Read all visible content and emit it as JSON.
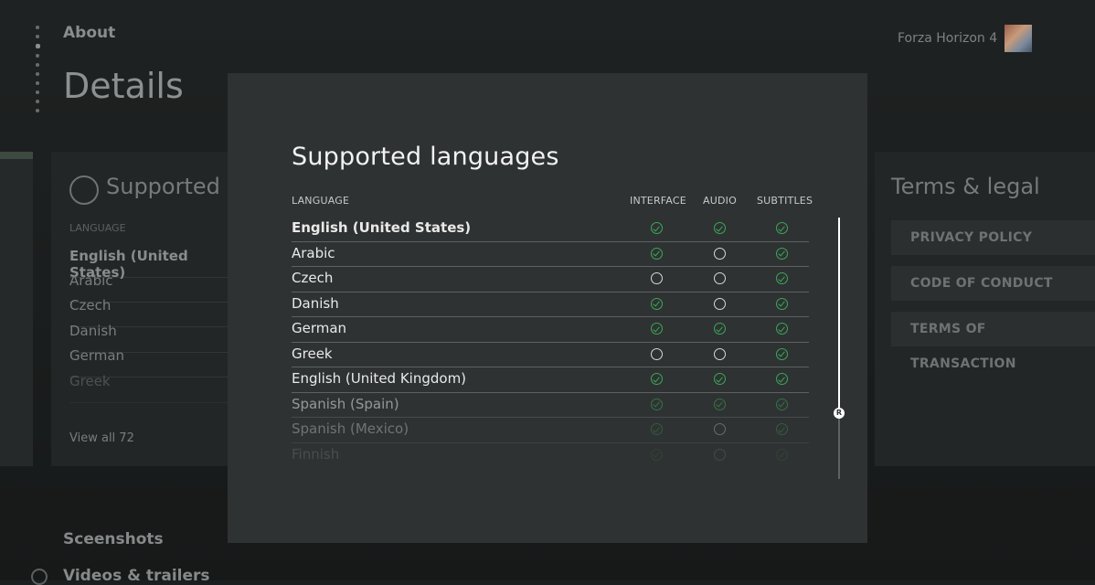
{
  "background": {
    "about_label": "About",
    "page_title": "Details",
    "game_title": "Forza Horizon 4",
    "languages_card": {
      "title": "Supported la",
      "header": "LANGUAGE",
      "rows": [
        "English (United States)",
        "Arabic",
        "Czech",
        "Danish",
        "German",
        "Greek"
      ],
      "view_all": "View all 72"
    },
    "terms_card": {
      "title": "Terms & legal",
      "buttons": [
        "PRIVACY POLICY",
        "CODE OF CONDUCT",
        "TERMS OF TRANSACTION"
      ]
    },
    "screenshots_label": "Sceenshots",
    "videos_label": "Videos & trailers"
  },
  "modal": {
    "title": "Supported languages",
    "columns": {
      "language": "LANGUAGE",
      "interface": "INTERFACE",
      "audio": "AUDIO",
      "subtitles": "SUBTITLES"
    },
    "rows": [
      {
        "name": "English (United States)",
        "interface": true,
        "audio": true,
        "subtitles": true
      },
      {
        "name": "Arabic",
        "interface": true,
        "audio": false,
        "subtitles": true
      },
      {
        "name": "Czech",
        "interface": false,
        "audio": false,
        "subtitles": true
      },
      {
        "name": "Danish",
        "interface": true,
        "audio": false,
        "subtitles": true
      },
      {
        "name": "German",
        "interface": true,
        "audio": true,
        "subtitles": true
      },
      {
        "name": "Greek",
        "interface": false,
        "audio": false,
        "subtitles": true
      },
      {
        "name": "English (United Kingdom)",
        "interface": true,
        "audio": true,
        "subtitles": true
      },
      {
        "name": "Spanish (Spain)",
        "interface": true,
        "audio": true,
        "subtitles": true
      },
      {
        "name": "Spanish (Mexico)",
        "interface": true,
        "audio": false,
        "subtitles": true
      },
      {
        "name": "Finnish",
        "interface": true,
        "audio": false,
        "subtitles": true
      }
    ],
    "scroll_button_glyph": "R",
    "colors": {
      "check": "#3aa85a",
      "panel": "#2f3232"
    }
  }
}
